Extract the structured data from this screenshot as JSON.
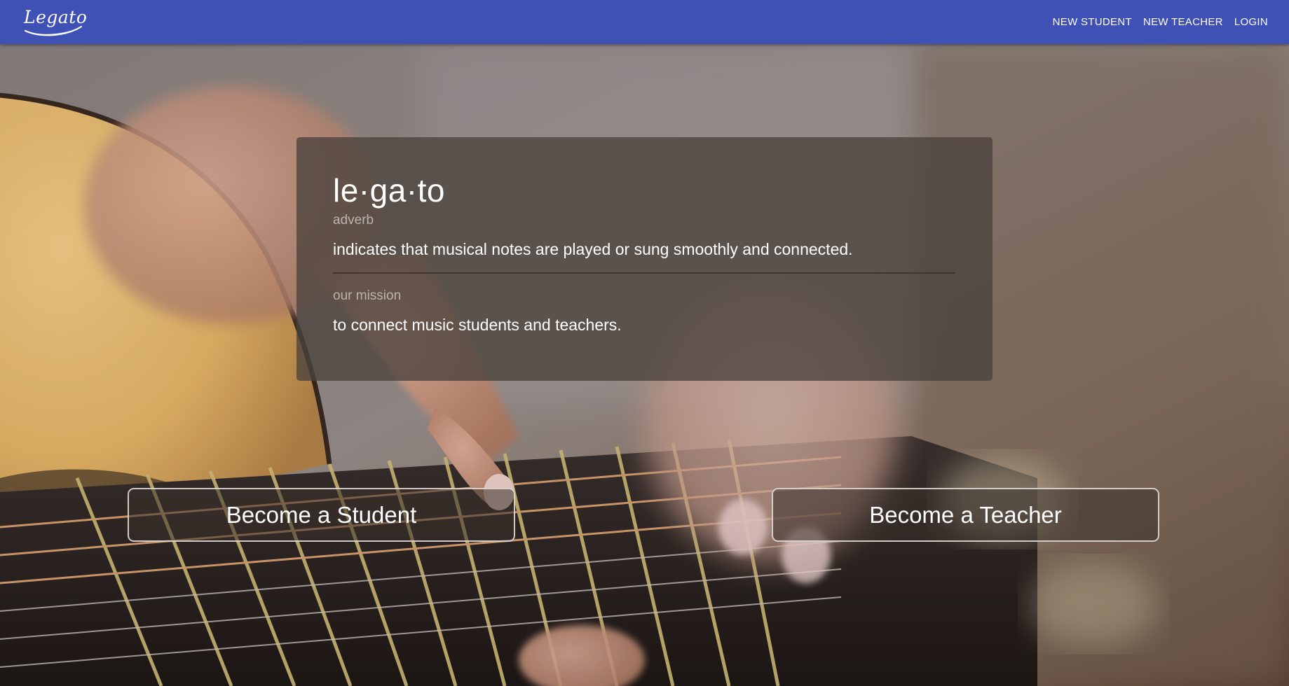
{
  "header": {
    "logo_text": "Legato",
    "nav": [
      {
        "label": "NEW STUDENT"
      },
      {
        "label": "NEW TEACHER"
      },
      {
        "label": "LOGIN"
      }
    ],
    "bar_color": "#3f51b5"
  },
  "definition_card": {
    "word": "le·ga·to",
    "part_of_speech": "adverb",
    "definition": "indicates that musical notes are played or sung smoothly and connected.",
    "mission_label": "our mission",
    "mission_text": "to connect music students and teachers."
  },
  "actions": {
    "student_button": "Become a Student",
    "teacher_button": "Become a Teacher"
  },
  "hero": {
    "image_subject": "guitar-fretboard-photo"
  }
}
